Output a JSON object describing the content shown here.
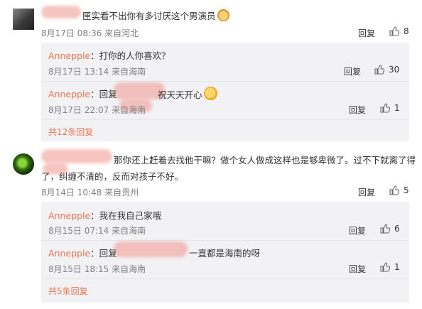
{
  "comments": [
    {
      "text": "匣实看不出你有多讨厌这个男演员",
      "emoji_name": "doge-emoji",
      "meta": "8月17日 08:36 来自河北",
      "reply_label": "回复",
      "likes": "8",
      "replies": [
        {
          "user": "Annepple",
          "text": "：打你的人你喜欢？",
          "meta": "8月17日 13:14 来自海南",
          "reply_label": "回复",
          "likes": "30"
        },
        {
          "user": "Annepple",
          "text_prefix": "：回复",
          "text_suffix": "祝天天开心",
          "emoji_name": "kiss-emoji",
          "meta": "8月17日 22:07 来自海南",
          "reply_label": "回复",
          "likes": "1"
        }
      ],
      "more": "共12条回复"
    },
    {
      "text_line1": "那你还上赶着去找他干嘛？做个女人做成这样也是够卑微了。过不下就离了得",
      "text_line2": "了，纠缠不清的，反而对孩子不好。",
      "meta": "8月14日 10:48 来自贵州",
      "reply_label": "回复",
      "likes": "5",
      "replies": [
        {
          "user": "Annepple",
          "text": "：我在我自己家哦",
          "meta": "8月15日 07:14 来自海南",
          "reply_label": "回复",
          "likes": "6"
        },
        {
          "user": "Annepple",
          "text_prefix": "：回复",
          "text_suffix": "一直都是海南的呀",
          "meta": "8月15日 18:15 来自海南",
          "reply_label": "回复",
          "likes": "1"
        }
      ],
      "more": "共5条回复"
    }
  ]
}
